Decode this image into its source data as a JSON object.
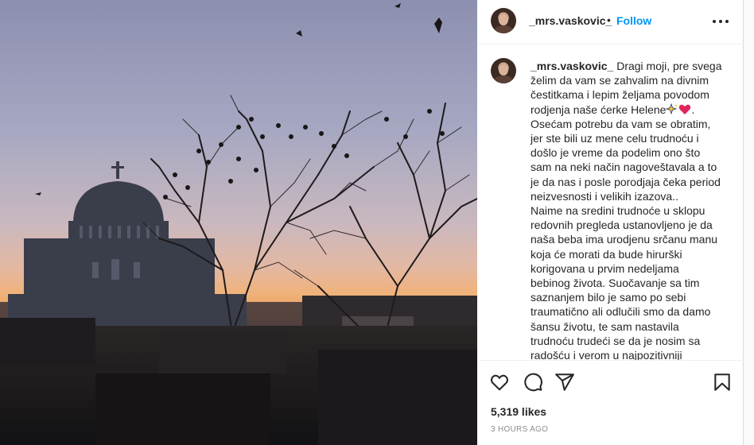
{
  "post": {
    "author": {
      "username": "_mrs.vaskovic_",
      "separator": "•",
      "follow_label": "Follow",
      "avatar_icon": "profile-avatar"
    },
    "more_icon": "more-horizontal-icon",
    "image": {
      "description_icon": "photo-sunset-cathedral"
    },
    "caption": {
      "username": "_mrs.vaskovic_",
      "lines": [
        "Dragi moji, pre svega",
        "želim da vam se zahvalim na divnim",
        "čestitkama i lepim željama povodom",
        "rodjenja naše ćerke Helene",
        "Osećam potrebu da vam se obratim,",
        "jer ste bili uz mene celu trudnoću i",
        "došlo je vreme da podelim ono što",
        "sam na neki način nagoveštavala a to",
        "je da nas i posle porodjaja čeka period",
        "neizvesnosti i velikih izazova..",
        "Naime na sredini trudnoće u sklopu",
        "redovnih pregleda ustanovljeno je da",
        "naša beba ima urodjenu srčanu manu",
        "koja će morati da bude hirurški",
        "korigovana u prvim nedeljama",
        "bebinog života. Suočavanje sa tim",
        "saznanjem bilo je samo po sebi",
        "traumatično ali odlučili smo da damo",
        "šansu životu, te sam nastavila",
        "trudnoću trudeći se da je nosim sa",
        "radošću i verom u najpozitivniji"
      ],
      "line4_suffix": "."
    },
    "actions": {
      "like_icon": "heart-icon",
      "comment_icon": "comment-icon",
      "share_icon": "share-icon",
      "save_icon": "bookmark-icon"
    },
    "likes": "5,319 likes",
    "timestamp": "3 HOURS AGO"
  },
  "colors": {
    "accent": "#0095f6",
    "text": "#262626",
    "muted": "#8e8e8e",
    "border": "#dbdbdb"
  }
}
